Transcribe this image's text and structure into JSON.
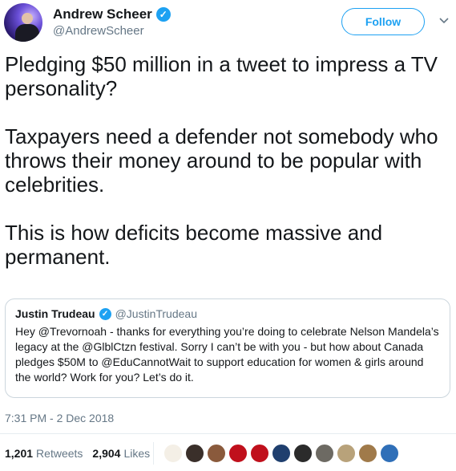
{
  "author": {
    "name": "Andrew Scheer",
    "handle": "@AndrewScheer",
    "verified_icon": "verified-badge-icon"
  },
  "follow_label": "Follow",
  "tweet": {
    "text": "Pledging $50 million in a tweet to impress a TV personality?\n\nTaxpayers need a defender not somebody who throws their money around to be popular with celebrities.\n\nThis is how deficits become massive and permanent."
  },
  "quoted": {
    "name": "Justin Trudeau",
    "handle": "@JustinTrudeau",
    "text": "Hey @Trevornoah - thanks for everything you’re doing to celebrate Nelson Mandela’s legacy at the @GlblCtzn festival. Sorry I can’t be with you - but how about Canada pledges $50M to @EduCannotWait to support education for women & girls around the world? Work for you? Let’s do it."
  },
  "timestamp": "7:31 PM - 2 Dec 2018",
  "stats": {
    "retweets_count": "1,201",
    "retweets_label": "Retweets",
    "likes_count": "2,904",
    "likes_label": "Likes"
  },
  "likers_colors": [
    "#f4efe6",
    "#3a2f2a",
    "#8a5a3c",
    "#c0101c",
    "#c0101c",
    "#1f3f6e",
    "#2b2b2b",
    "#6d6a63",
    "#b8a27a",
    "#a07a4a",
    "#2f6fb8"
  ],
  "colors": {
    "accent": "#1da1f2",
    "text": "#14171a",
    "muted": "#657786",
    "border": "#ccd6dd"
  }
}
